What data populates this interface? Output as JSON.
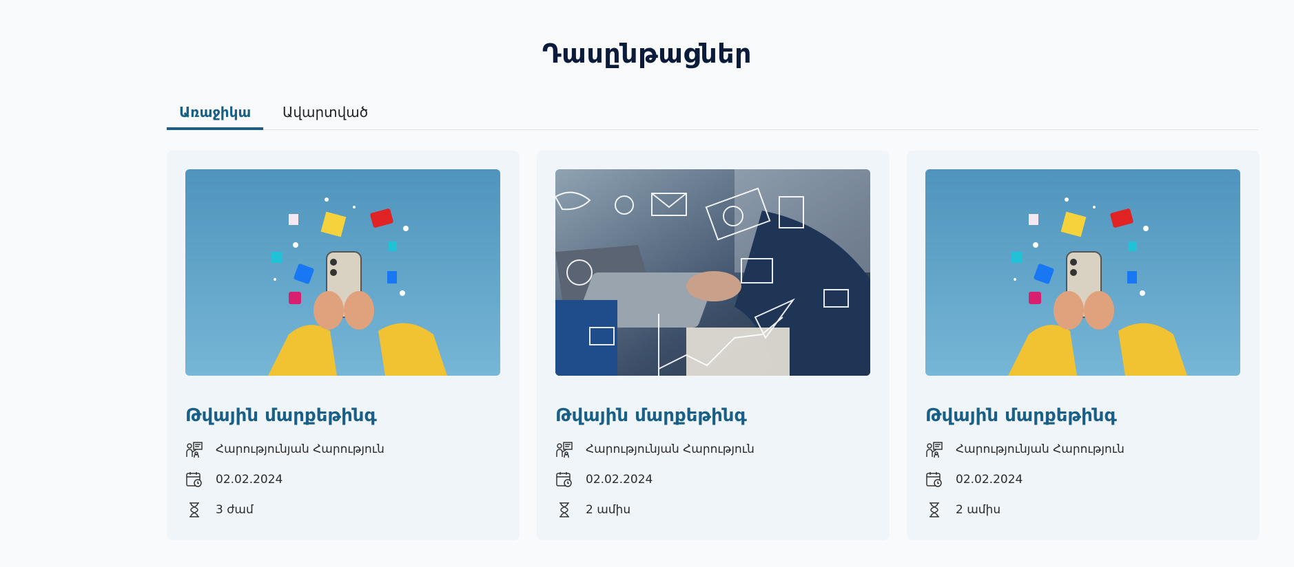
{
  "page": {
    "title": "Դասընթացներ"
  },
  "tabs": [
    {
      "label": "Առաջիկա",
      "active": true
    },
    {
      "label": "Ավարտված",
      "active": false
    }
  ],
  "cards": [
    {
      "image": "social-media-phone-image",
      "title": "Թվային մարքեթինգ",
      "instructor": "Հարությունյան Հարություն",
      "date": "02.02.2024",
      "duration": "3 ժամ"
    },
    {
      "image": "business-laptop-image",
      "title": "Թվային մարքեթինգ",
      "instructor": "Հարությունյան Հարություն",
      "date": "02.02.2024",
      "duration": "2 ամիս"
    },
    {
      "image": "social-media-phone-image",
      "title": "Թվային մարքեթինգ",
      "instructor": "Հարությունյան Հարություն",
      "date": "02.02.2024",
      "duration": "2 ամիս"
    }
  ],
  "icons": {
    "instructor": "presenter-icon",
    "date": "calendar-clock-icon",
    "duration": "hourglass-icon"
  },
  "colors": {
    "accent": "#1a5f86",
    "title": "#0b1b3a",
    "card_bg": "#f0f5f9",
    "page_bg": "#f9fafb"
  }
}
